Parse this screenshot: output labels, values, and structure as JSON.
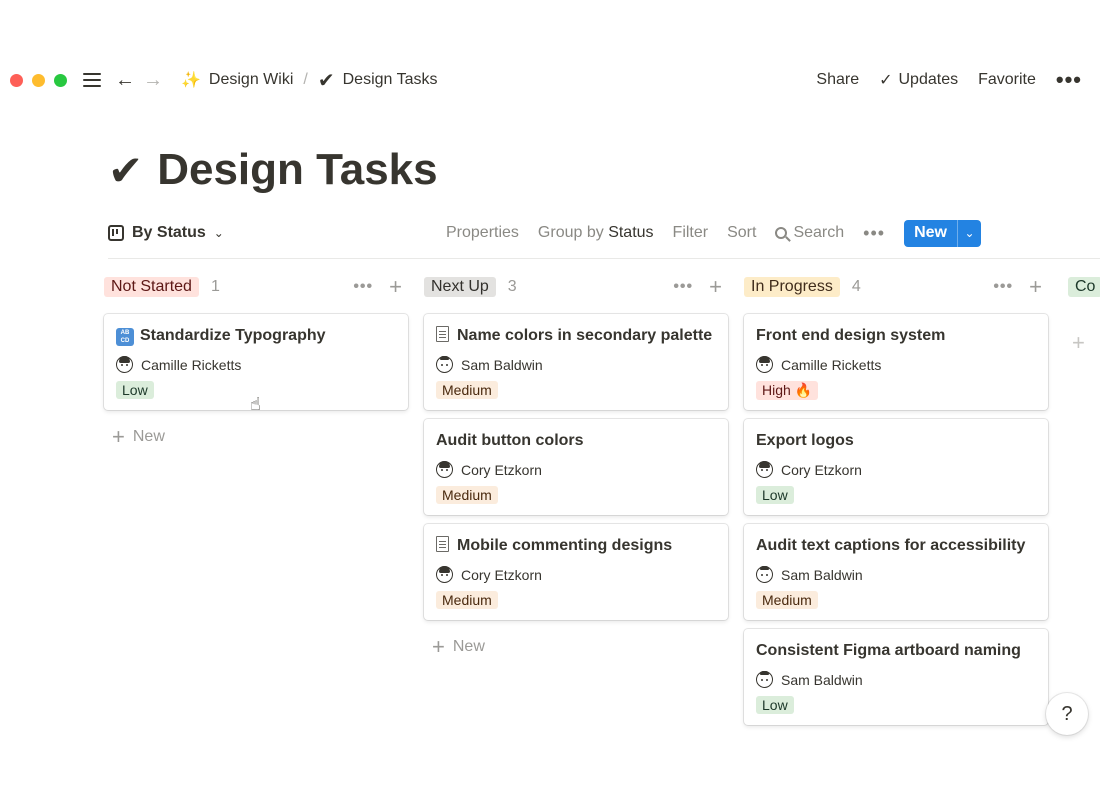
{
  "window": {
    "controls": [
      "close",
      "minimize",
      "maximize"
    ]
  },
  "breadcrumb": [
    {
      "icon": "sparkles-icon",
      "emoji": "✨",
      "label": "Design Wiki"
    },
    {
      "icon": "checkmark-icon",
      "emoji": "✔",
      "label": "Design Tasks"
    }
  ],
  "breadcrumb_separator": "/",
  "top_actions": {
    "share": "Share",
    "updates": "Updates",
    "favorite": "Favorite"
  },
  "page": {
    "title": "Design Tasks",
    "title_icon": "✔"
  },
  "view": {
    "name": "By Status",
    "properties": "Properties",
    "group_by_prefix": "Group by",
    "group_by_value": "Status",
    "filter": "Filter",
    "sort": "Sort",
    "search": "Search",
    "new_button": "New"
  },
  "columns": [
    {
      "name": "Not Started",
      "count": "1",
      "tag_bg": "#ffe2dd",
      "tag_fg": "#5d1715",
      "cards": [
        {
          "title": "Standardize Typography",
          "icon": "abc",
          "person": "Camille Ricketts",
          "priority": "Low"
        }
      ]
    },
    {
      "name": "Next Up",
      "count": "3",
      "tag_bg": "#e3e2e0",
      "tag_fg": "#32302c",
      "cards": [
        {
          "title": "Name colors in secondary palette",
          "icon": "doc",
          "person": "Sam Baldwin",
          "priority": "Medium"
        },
        {
          "title": "Audit button colors",
          "icon": "",
          "person": "Cory Etzkorn",
          "priority": "Medium"
        },
        {
          "title": "Mobile commenting designs",
          "icon": "doc",
          "person": "Cory Etzkorn",
          "priority": "Medium"
        }
      ]
    },
    {
      "name": "In Progress",
      "count": "4",
      "tag_bg": "#fdecc8",
      "tag_fg": "#402c1b",
      "cards": [
        {
          "title": "Front end design system",
          "icon": "",
          "person": "Camille Ricketts",
          "priority": "High 🔥"
        },
        {
          "title": "Export logos",
          "icon": "",
          "person": "Cory Etzkorn",
          "priority": "Low"
        },
        {
          "title": "Audit text captions for accessibility",
          "icon": "",
          "person": "Sam Baldwin",
          "priority": "Medium"
        },
        {
          "title": "Consistent Figma artboard naming",
          "icon": "",
          "person": "Sam Baldwin",
          "priority": "Low"
        }
      ]
    }
  ],
  "partial_column": {
    "name": "Co"
  },
  "add_new_label": "New",
  "help_label": "?",
  "abc_icon_text": "AB CD"
}
